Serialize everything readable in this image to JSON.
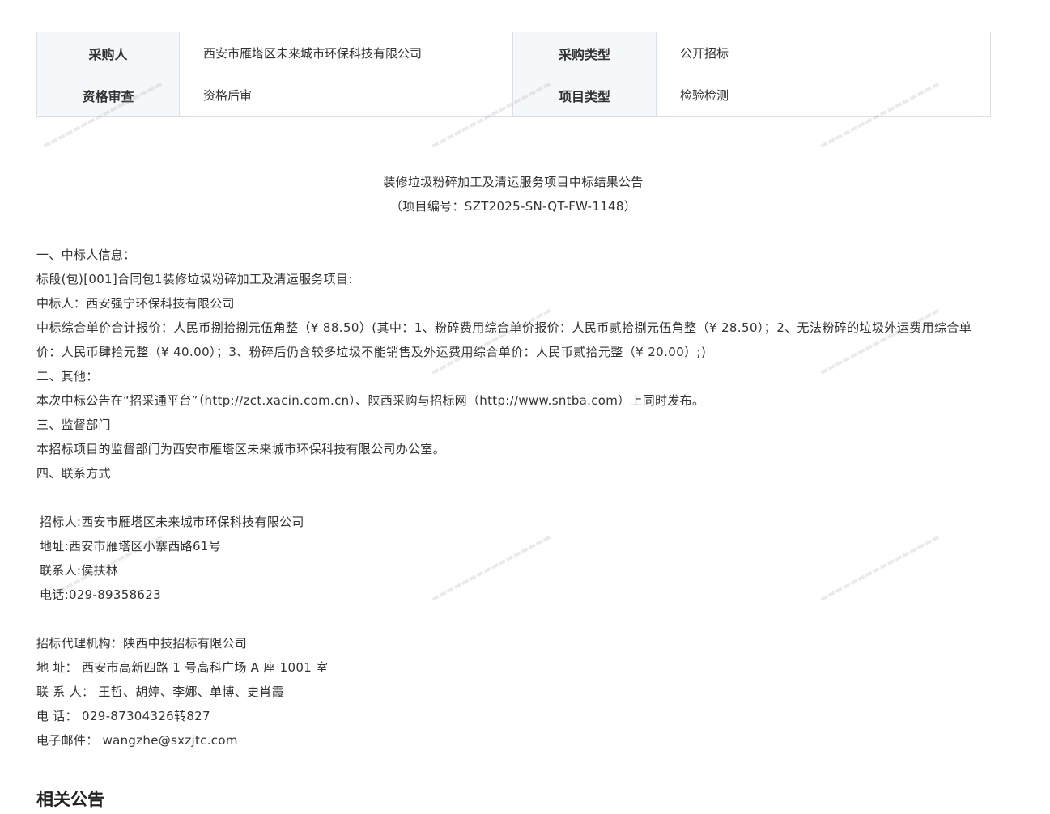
{
  "info_table": {
    "purchaser_label": "采购人",
    "purchaser_value": "西安市雁塔区未来城市环保科技有限公司",
    "purchase_type_label": "采购类型",
    "purchase_type_value": "公开招标",
    "qualification_label": "资格审查",
    "qualification_value": "资格后审",
    "project_type_label": "项目类型",
    "project_type_value": "检验检测"
  },
  "notice": {
    "title": "装修垃圾粉碎加工及清运服务项目中标结果公告",
    "project_no": "（项目编号：SZT2025-SN-QT-FW-1148）",
    "s1_heading": "一、中标人信息：",
    "s1_lot": "标段(包)[001]合同包1装修垃圾粉碎加工及清运服务项目:",
    "s1_winner": "中标人：西安强宁环保科技有限公司",
    "s1_price": "中标综合单价合计报价：人民币捌拾捌元伍角整（¥ 88.50）(其中：1、粉碎费用综合单价报价：人民币贰拾捌元伍角整（¥ 28.50）；2、无法粉碎的垃圾外运费用综合单价：人民币肆拾元整（¥ 40.00）；3、粉碎后仍含较多垃圾不能销售及外运费用综合单价：人民币贰拾元整（¥ 20.00）;)",
    "s2_heading": "二、其他：",
    "s2_text": "本次中标公告在“招采通平台”（http://zct.xacin.com.cn）、陕西采购与招标网（http://www.sntba.com）上同时发布。",
    "s3_heading": "三、监督部门",
    "s3_text": "本招标项目的监督部门为西安市雁塔区未来城市环保科技有限公司办公室。",
    "s4_heading": "四、联系方式",
    "tenderer": "招标人:西安市雁塔区未来城市环保科技有限公司",
    "tenderer_address": "地址:西安市雁塔区小寨西路61号",
    "tenderer_contact": "联系人:侯扶林",
    "tenderer_phone": "电话:029-89358623",
    "agency": "招标代理机构：陕西中技招标有限公司",
    "agency_address": "地 址： 西安市高新四路 1 号高科广场 A 座 1001 室",
    "agency_contacts": "联 系 人： 王哲、胡婷、李娜、单博、史肖霞",
    "agency_phone": "电 话： 029-87304326转827",
    "agency_email": "电子邮件： wangzhe@sxzjtc.com"
  },
  "related_heading": "相关公告"
}
